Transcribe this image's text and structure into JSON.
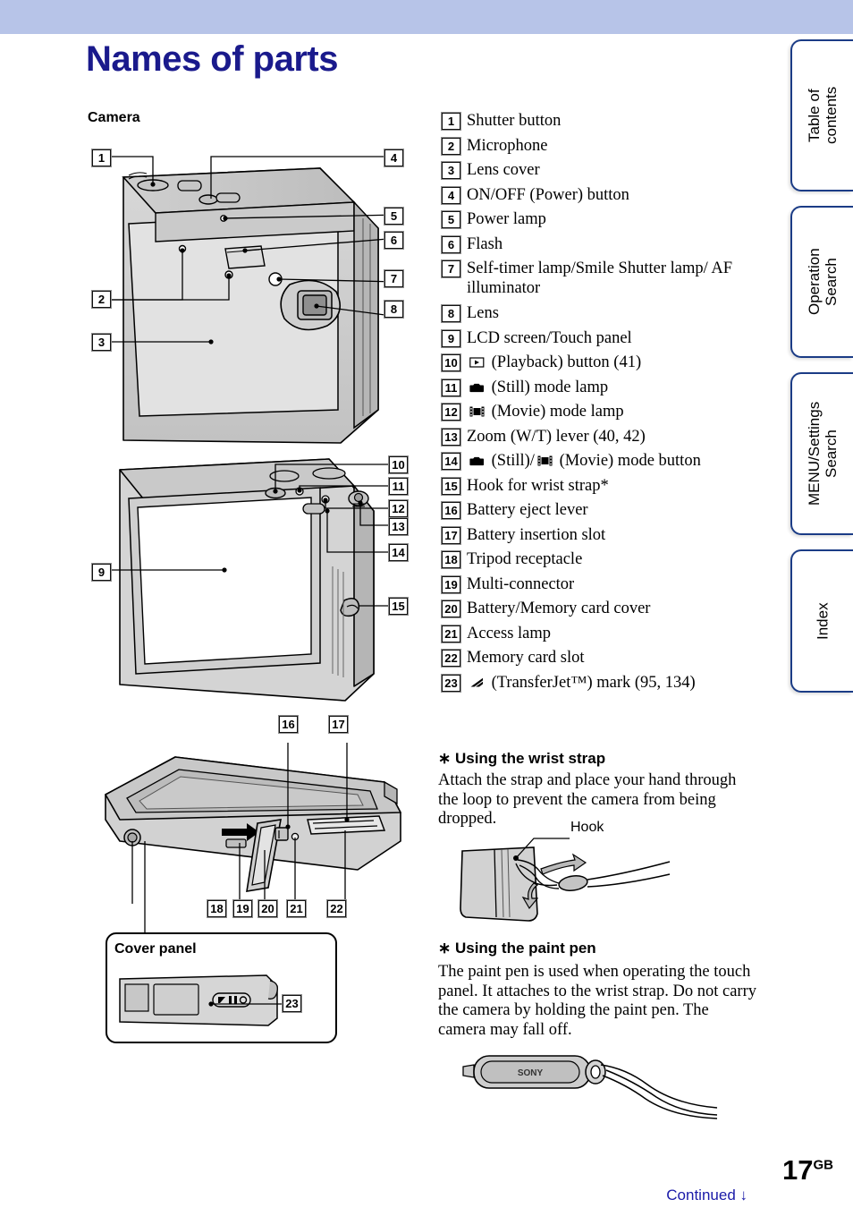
{
  "header": {
    "title": "Names of parts",
    "band_color": "#b7c4e8",
    "title_color": "#1a1a8c"
  },
  "tabs": [
    {
      "label": "Table of\ncontents"
    },
    {
      "label": "Operation\nSearch"
    },
    {
      "label": "MENU/Settings\nSearch"
    },
    {
      "label": "Index"
    }
  ],
  "left": {
    "camera_heading": "Camera",
    "cover_panel_label": "Cover panel",
    "callouts_front": [
      "1",
      "2",
      "3",
      "4",
      "5",
      "6",
      "7",
      "8"
    ],
    "callouts_rear": [
      "9",
      "10",
      "11",
      "12",
      "13",
      "14",
      "15"
    ],
    "callouts_bottom": [
      "16",
      "17",
      "18",
      "19",
      "20",
      "21",
      "22"
    ],
    "callouts_cover": [
      "23"
    ]
  },
  "parts": [
    {
      "num": "1",
      "icon": "",
      "text": "Shutter button"
    },
    {
      "num": "2",
      "icon": "",
      "text": "Microphone"
    },
    {
      "num": "3",
      "icon": "",
      "text": "Lens cover"
    },
    {
      "num": "4",
      "icon": "",
      "text": "ON/OFF (Power) button"
    },
    {
      "num": "5",
      "icon": "",
      "text": "Power lamp"
    },
    {
      "num": "6",
      "icon": "",
      "text": "Flash"
    },
    {
      "num": "7",
      "icon": "",
      "text": "Self-timer lamp/Smile Shutter lamp/ AF illuminator"
    },
    {
      "num": "8",
      "icon": "",
      "text": "Lens"
    },
    {
      "num": "9",
      "icon": "",
      "text": "LCD screen/Touch panel"
    },
    {
      "num": "10",
      "icon": "playback-icon",
      "text": "(Playback) button (41)"
    },
    {
      "num": "11",
      "icon": "still-camera-icon",
      "text": "(Still) mode lamp"
    },
    {
      "num": "12",
      "icon": "movie-film-icon",
      "text": "(Movie) mode lamp"
    },
    {
      "num": "13",
      "icon": "",
      "text": "Zoom (W/T) lever (40, 42)"
    },
    {
      "num": "14",
      "icon": "still-movie-icon",
      "text": "(Still)/ (Movie) mode button"
    },
    {
      "num": "15",
      "icon": "",
      "text": "Hook for wrist strap*"
    },
    {
      "num": "16",
      "icon": "",
      "text": "Battery eject lever"
    },
    {
      "num": "17",
      "icon": "",
      "text": "Battery insertion slot"
    },
    {
      "num": "18",
      "icon": "",
      "text": "Tripod receptacle"
    },
    {
      "num": "19",
      "icon": "",
      "text": "Multi-connector"
    },
    {
      "num": "20",
      "icon": "",
      "text": "Battery/Memory card cover"
    },
    {
      "num": "21",
      "icon": "",
      "text": "Access lamp"
    },
    {
      "num": "22",
      "icon": "",
      "text": "Memory card slot"
    },
    {
      "num": "23",
      "icon": "transferjet-icon",
      "text": "(TransferJet™) mark (95, 134)"
    }
  ],
  "wrist_strap": {
    "heading": "∗ Using the wrist strap",
    "body": "Attach the strap and place your hand through the loop to prevent the camera from being dropped.",
    "hook_label": "Hook"
  },
  "paint_pen": {
    "heading": "∗ Using the paint pen",
    "body": "The paint pen is used when operating the touch panel. It attaches to the wrist strap. Do not carry the camera by holding the paint pen. The camera may fall off.",
    "brand": "SONY"
  },
  "footer": {
    "page_number": "17",
    "page_suffix": "GB",
    "continued": "Continued ↓",
    "continued_color": "#1a1aa8"
  }
}
